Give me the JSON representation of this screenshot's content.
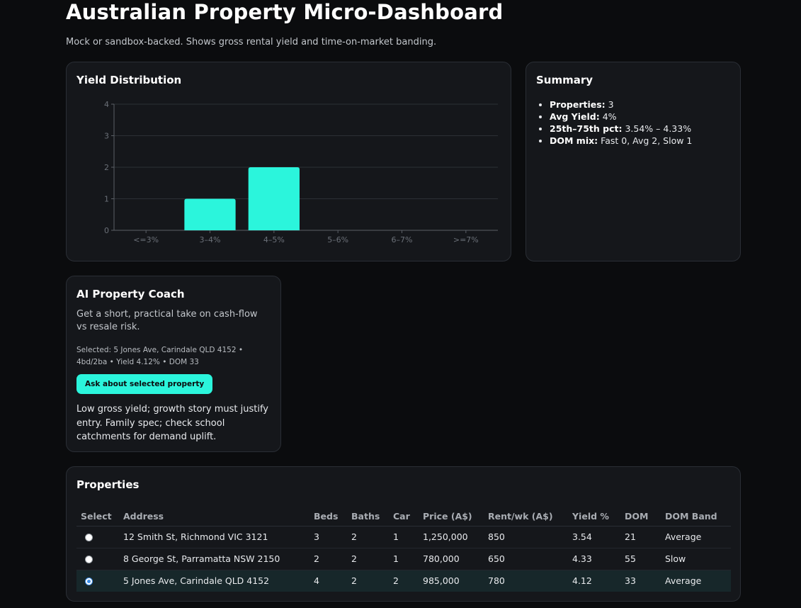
{
  "header": {
    "title": "Australian Property Micro-Dashboard",
    "subtitle": "Mock or sandbox-backed. Shows gross rental yield and time-on-market banding."
  },
  "yield_card": {
    "title": "Yield Distribution"
  },
  "chart_data": {
    "type": "bar",
    "categories": [
      "<=3%",
      "3–4%",
      "4–5%",
      "5–6%",
      "6–7%",
      ">=7%"
    ],
    "values": [
      0,
      1,
      2,
      0,
      0,
      0
    ],
    "ylim": [
      0,
      4
    ],
    "yticks": [
      "0",
      "1",
      "2",
      "3",
      "4"
    ],
    "grid": true,
    "bar_color": "#2bf5dc"
  },
  "summary": {
    "title": "Summary",
    "items": [
      {
        "label": "Properties:",
        "value": "3"
      },
      {
        "label": "Avg Yield:",
        "value": "4%"
      },
      {
        "label": "25th–75th pct:",
        "value": "3.54% – 4.33%"
      },
      {
        "label": "DOM mix:",
        "value": "Fast 0, Avg 2, Slow 1"
      }
    ]
  },
  "coach": {
    "title": "AI Property Coach",
    "description": "Get a short, practical take on cash-flow vs resale risk.",
    "selected": "Selected: 5 Jones Ave, Carindale QLD 4152 • 4bd/2ba • Yield 4.12% • DOM 33",
    "button_label": "Ask about selected property",
    "answer": "Low gross yield; growth story must justify entry. Family spec; check school catchments for demand uplift."
  },
  "properties": {
    "title": "Properties",
    "columns": [
      "Select",
      "Address",
      "Beds",
      "Baths",
      "Car",
      "Price (A$)",
      "Rent/wk (A$)",
      "Yield %",
      "DOM",
      "DOM Band"
    ],
    "rows": [
      {
        "address": "12 Smith St, Richmond VIC 3121",
        "beds": "3",
        "baths": "2",
        "car": "1",
        "price": "1,250,000",
        "rent": "850",
        "yield": "3.54",
        "dom": "21",
        "band": "Average",
        "selected": false
      },
      {
        "address": "8 George St, Parramatta NSW 2150",
        "beds": "2",
        "baths": "2",
        "car": "1",
        "price": "780,000",
        "rent": "650",
        "yield": "4.33",
        "dom": "55",
        "band": "Slow",
        "selected": false
      },
      {
        "address": "5 Jones Ave, Carindale QLD 4152",
        "beds": "4",
        "baths": "2",
        "car": "2",
        "price": "985,000",
        "rent": "780",
        "yield": "4.12",
        "dom": "33",
        "band": "Average",
        "selected": true
      }
    ]
  },
  "colors": {
    "accent": "#2bf5dc",
    "background": "#0b0c0e",
    "card": "#15171b"
  }
}
